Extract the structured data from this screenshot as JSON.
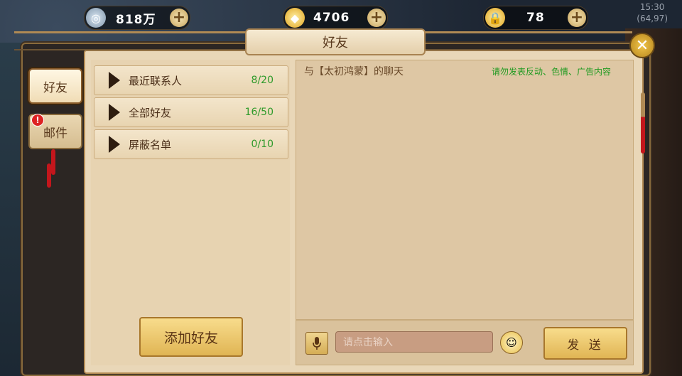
{
  "currency": {
    "silver": {
      "value": "818万",
      "icon": "coin-icon"
    },
    "gold": {
      "value": "4706",
      "icon": "gold-ingot-icon"
    },
    "bound_gold": {
      "value": "78",
      "icon": "locked-ingot-icon"
    }
  },
  "clock": {
    "time": "15:30",
    "ping": "(64,97)"
  },
  "dialog": {
    "title": "好友",
    "tabs": [
      {
        "label": "好友",
        "active": true
      },
      {
        "label": "邮件",
        "active": false,
        "badge": "!"
      }
    ],
    "friend_groups": [
      {
        "label": "最近联系人",
        "count": "8/20"
      },
      {
        "label": "全部好友",
        "count": "16/50"
      },
      {
        "label": "屏蔽名单",
        "count": "0/10"
      }
    ],
    "add_friend_label": "添加好友",
    "chat": {
      "title": "与【太初鸿蒙】的聊天",
      "warning": "请勿发表反动、色情、广告内容",
      "input_placeholder": "请点击输入",
      "send_label": "发 送"
    }
  },
  "colors": {
    "accent_green": "#2e9a2a",
    "panel": "#e9d7b8",
    "button_gold": "#e0b554"
  }
}
